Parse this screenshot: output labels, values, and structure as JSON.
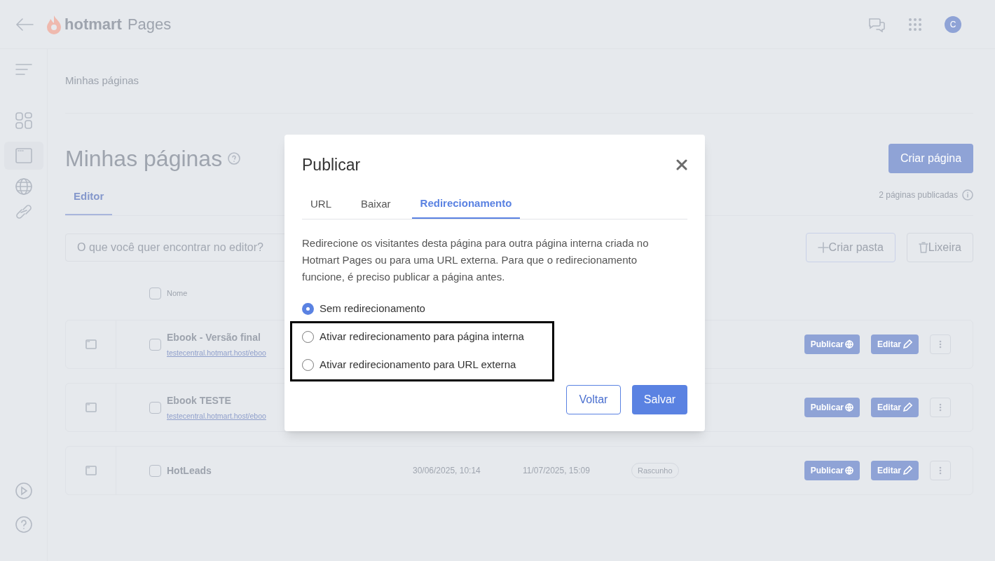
{
  "header": {
    "brand": "hotmart",
    "product": "Pages",
    "avatar": "C"
  },
  "breadcrumb": "Minhas páginas",
  "page_title": "Minhas páginas",
  "create_button": "Criar página",
  "tabs": [
    {
      "label": "Editor",
      "selected": true
    }
  ],
  "published_count": "2 páginas publicadas",
  "search": {
    "placeholder": "O que você quer encontrar no editor?"
  },
  "actions": [
    "Criar pasta",
    "Lixeira"
  ],
  "table": {
    "select_all_checked": false,
    "columns": [
      "Nome"
    ],
    "rows": [
      {
        "checked": false,
        "name": "Ebook - Versão final",
        "url": "testecentral.hotmart.host/eboo",
        "publish": "Publicar",
        "edit": "Editar"
      },
      {
        "checked": false,
        "name": "Ebook TESTE",
        "url": "testecentral.hotmart.host/eboo",
        "publish": "Publicar",
        "edit": "Editar"
      },
      {
        "checked": false,
        "name": "HotLeads",
        "created": "30/06/2025, 10:14",
        "updated": "11/07/2025, 15:09",
        "status": "Rascunho",
        "publish": "Publicar",
        "edit": "Editar"
      }
    ]
  },
  "dialog": {
    "title": "Publicar",
    "tabs": [
      {
        "label": "URL",
        "selected": false
      },
      {
        "label": "Baixar",
        "selected": false
      },
      {
        "label": "Redirecionamento",
        "selected": true
      }
    ],
    "description": "Redirecione os visitantes desta página para outra página interna criada no Hotmart Pages ou para uma URL externa. Para que o redirecionamento funcione, é preciso publicar a página antes.",
    "options": [
      {
        "label": "Sem redirecionamento",
        "selected": true,
        "highlighted": false
      },
      {
        "label": "Ativar redirecionamento para página interna",
        "selected": false,
        "highlighted": true
      },
      {
        "label": "Ativar redirecionamento para URL externa",
        "selected": false,
        "highlighted": true
      }
    ],
    "buttons": {
      "back": "Voltar",
      "save": "Salvar"
    }
  }
}
